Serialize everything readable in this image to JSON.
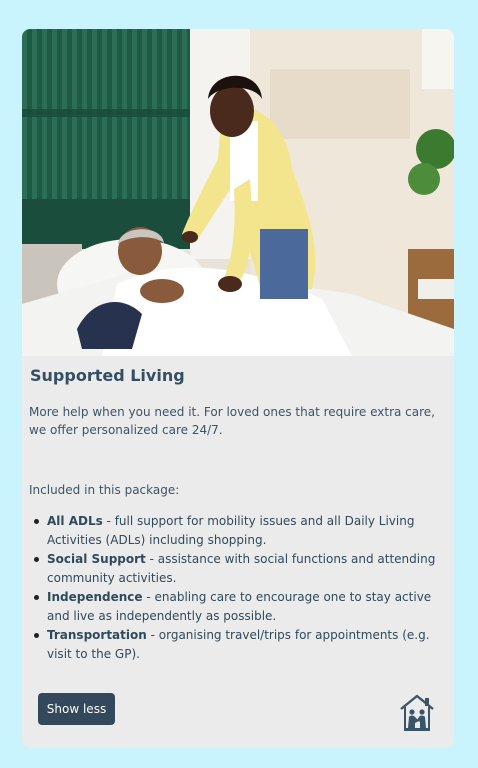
{
  "card": {
    "image_alt": "Caregiver tucking an elderly man into bed",
    "title": "Supported Living",
    "intro": "More help when you need it. For loved ones that require extra care, we offer personalized care 24/7.",
    "included_label": "Included in this package:",
    "features": [
      {
        "name": "All ADLs",
        "text": " - full support for mobility issues and all Daily Living Activities (ADLs) including shopping."
      },
      {
        "name": "Social Support",
        "text": " - assistance with social functions and attending community activities."
      },
      {
        "name": "Independence",
        "text": " - enabling care to encourage one to stay active and live as independently as possible."
      },
      {
        "name": "Transportation",
        "text": " - organising travel/trips for appointments (e.g. visit to the GP)."
      }
    ],
    "toggle_label": "Show less",
    "icon": "home-care-icon"
  },
  "colors": {
    "page_background": "#c9f3fd",
    "card_background": "#ebebeb",
    "button_background": "#33485a",
    "text": "#2f4a5c"
  }
}
